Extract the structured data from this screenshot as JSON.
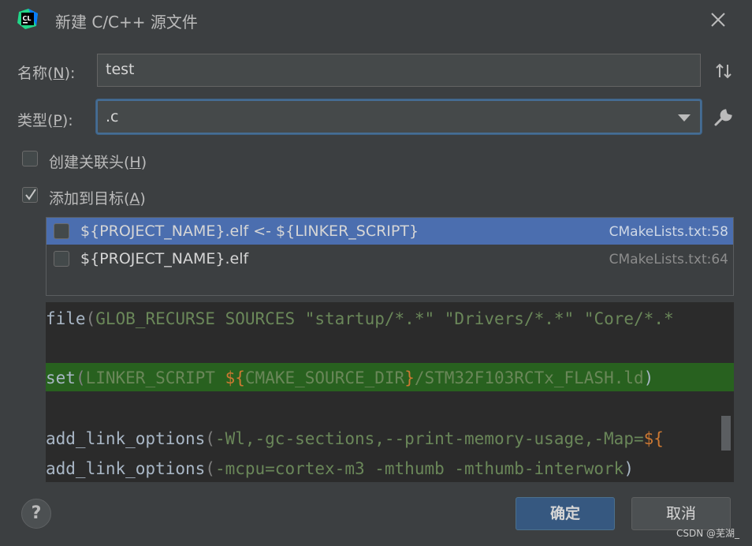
{
  "dialog": {
    "title": "新建 C/C++ 源文件",
    "app_logo_text": "CL"
  },
  "form": {
    "name_label": "名称(",
    "name_mnemonic": "N",
    "name_label_end": "):",
    "name_value": "test",
    "type_label": "类型(",
    "type_mnemonic": "P",
    "type_label_end": "):",
    "type_value": ".c",
    "create_header_label": "创建关联头(",
    "create_header_mnemonic": "H",
    "create_header_end": ")",
    "create_header_checked": false,
    "add_to_target_label": "添加到目标(",
    "add_to_target_mnemonic": "A",
    "add_to_target_end": ")",
    "add_to_target_checked": true
  },
  "targets": [
    {
      "name": "${PROJECT_NAME}.elf <- ${LINKER_SCRIPT}",
      "file": "CMakeLists.txt:58",
      "selected": true,
      "checked": false
    },
    {
      "name": "${PROJECT_NAME}.elf",
      "file": "CMakeLists.txt:64",
      "selected": false,
      "checked": false
    }
  ],
  "code": {
    "l1_fn": "file",
    "l1_rest": "GLOB_RECURSE SOURCES ",
    "l1_s1": "\"startup/*.*\"",
    "l1_s2": "\"Drivers/*.*\"",
    "l1_s3": "\"Core/*.*",
    "l2_fn": "set",
    "l2_var": "LINKER_SCRIPT ",
    "l2_dollar": "${",
    "l2_dir": "CMAKE_SOURCE_DIR",
    "l2_close": "}",
    "l2_path": "/STM32F103RCTx_FLASH.ld",
    "l3_fn": "add_link_options",
    "l3_args": "-Wl,-gc-sections,--print-memory-usage,-Map=",
    "l3_dollar": "${",
    "l4_fn": "add_link_options",
    "l4_args": "-mcpu=cortex-m3 -mthumb -mthumb-interwork"
  },
  "footer": {
    "help_label": "?",
    "ok_label": "确定",
    "cancel_label": "取消",
    "watermark": "CSDN @芜湖_"
  },
  "colors": {
    "selection": "#4b6eaf",
    "ok_button": "#365880",
    "highlight_line": "#28611f"
  }
}
